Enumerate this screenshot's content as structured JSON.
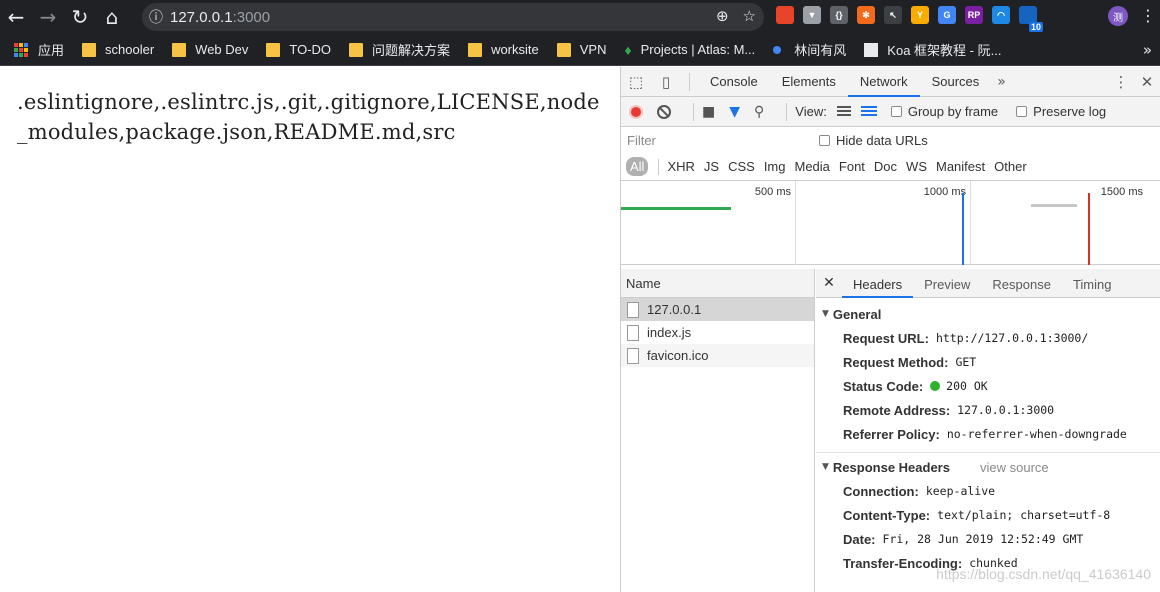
{
  "browser": {
    "url_host": "127.0.0.1",
    "url_port": ":3000",
    "nav": {
      "back": "←",
      "forward": "→",
      "reload": "↻",
      "home": "⌂",
      "info": "ⓘ",
      "zoom": "⊕",
      "star": "☆",
      "menu": "⋮"
    },
    "extensions": [
      {
        "name": "flame-extension-icon",
        "color": "#e8442a",
        "text": ""
      },
      {
        "name": "vue-extension-icon",
        "color": "#9aa0a6",
        "text": "▼"
      },
      {
        "name": "braces-extension-icon",
        "color": "#5f6368",
        "text": "{}"
      },
      {
        "name": "orange-extension-icon",
        "color": "#f26b1d",
        "text": "✻"
      },
      {
        "name": "cursor-extension-icon",
        "color": "#3c4043",
        "text": "↖"
      },
      {
        "name": "yellow-y-extension-icon",
        "color": "#f9ab00",
        "text": "Y"
      },
      {
        "name": "translate-extension-icon",
        "color": "#4285f4",
        "text": "G"
      },
      {
        "name": "rp-extension-icon",
        "color": "#7b1fa2",
        "text": "RP"
      },
      {
        "name": "wifi-extension-icon",
        "color": "#1e88e5",
        "text": "◠"
      },
      {
        "name": "badge-extension-icon",
        "color": "#1565c0",
        "text": "",
        "badge": "10"
      }
    ],
    "avatar_text": "测",
    "bookmarks": [
      {
        "label": "应用",
        "type": "apps"
      },
      {
        "label": "schooler",
        "type": "folder"
      },
      {
        "label": "Web Dev",
        "type": "folder"
      },
      {
        "label": "TO-DO",
        "type": "folder"
      },
      {
        "label": "问题解决方案",
        "type": "folder"
      },
      {
        "label": "worksite",
        "type": "folder"
      },
      {
        "label": "VPN",
        "type": "folder"
      },
      {
        "label": "Projects | Atlas: M...",
        "type": "leaf"
      },
      {
        "label": "林间有风",
        "type": "dot"
      },
      {
        "label": "Koa 框架教程 - 阮...",
        "type": "koa"
      }
    ],
    "bookmarks_more": "»"
  },
  "page": {
    "text": ".eslintignore,.eslintrc.js,.git,.gitignore,LICENSE,node_modules,package.json,README.md,src"
  },
  "devtools": {
    "tabs": [
      "Console",
      "Elements",
      "Network",
      "Sources"
    ],
    "active_tab": "Network",
    "more_tabs": "»",
    "toolbar": {
      "view_label": "View:",
      "group_by_frame": "Group by frame",
      "preserve_log": "Preserve log"
    },
    "filter_placeholder": "Filter",
    "hide_data_urls": "Hide data URLs",
    "type_filters": [
      "All",
      "XHR",
      "JS",
      "CSS",
      "Img",
      "Media",
      "Font",
      "Doc",
      "WS",
      "Manifest",
      "Other"
    ],
    "timeline_labels": [
      "500 ms",
      "1000 ms",
      "1500 ms"
    ],
    "name_header": "Name",
    "requests": [
      "127.0.0.1",
      "index.js",
      "favicon.ico"
    ],
    "detail_tabs": [
      "Headers",
      "Preview",
      "Response",
      "Timing"
    ],
    "general": {
      "title": "General",
      "items": [
        {
          "k": "Request URL:",
          "v": "http://127.0.0.1:3000/"
        },
        {
          "k": "Request Method:",
          "v": "GET"
        },
        {
          "k": "Status Code:",
          "v": "200 OK"
        },
        {
          "k": "Remote Address:",
          "v": "127.0.0.1:3000"
        },
        {
          "k": "Referrer Policy:",
          "v": "no-referrer-when-downgrade"
        }
      ]
    },
    "response_headers": {
      "title": "Response Headers",
      "view_source": "view source",
      "items": [
        {
          "k": "Connection:",
          "v": "keep-alive"
        },
        {
          "k": "Content-Type:",
          "v": "text/plain; charset=utf-8"
        },
        {
          "k": "Date:",
          "v": "Fri, 28 Jun 2019 12:52:49 GMT"
        },
        {
          "k": "Transfer-Encoding:",
          "v": "chunked"
        }
      ]
    },
    "watermark": "https://blog.csdn.net/qq_41636140"
  },
  "colors": {
    "accent": "#1a73e8",
    "record": "#e53935",
    "status_ok": "#2db32d",
    "folder": "#f6c344"
  }
}
